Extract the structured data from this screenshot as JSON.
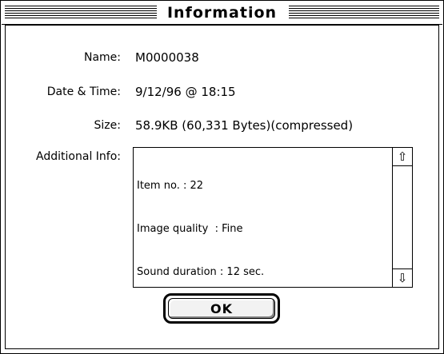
{
  "window": {
    "title": "Information"
  },
  "fields": {
    "name": {
      "label": "Name:",
      "value": "M0000038"
    },
    "datetime": {
      "label": "Date & Time:",
      "value": "9/12/96 @ 18:15"
    },
    "size": {
      "label": "Size:",
      "value": "58.9KB (60,331 Bytes)(compressed)"
    },
    "additional": {
      "label": "Additional Info:",
      "lines": [
        "Item no. : 22",
        "Image quality  : Fine",
        "Sound duration : 12 sec."
      ]
    }
  },
  "buttons": {
    "ok": "OK"
  },
  "icons": {
    "scroll_up": "up-arrow-icon",
    "scroll_down": "down-arrow-icon"
  }
}
